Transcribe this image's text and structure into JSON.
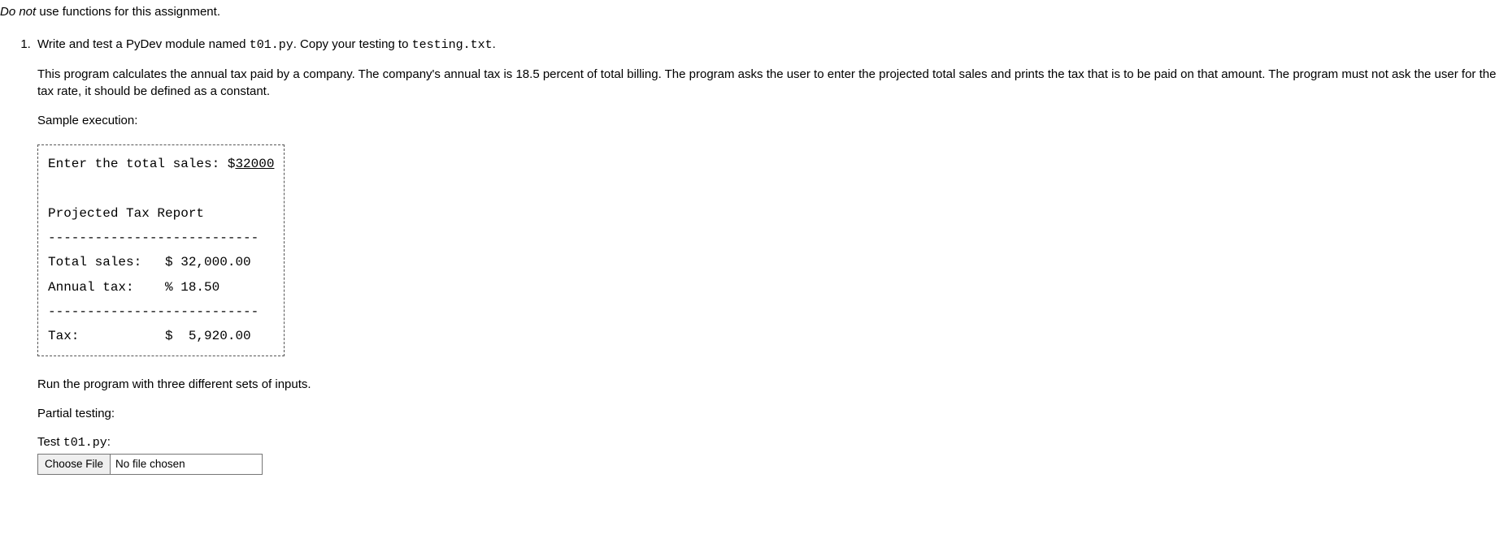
{
  "intro": {
    "italic_prefix": "Do not",
    "rest": " use functions for this assignment."
  },
  "q1": {
    "lead_a": "Write and test a PyDev module named ",
    "code_module": "t01.py",
    "lead_b": ". Copy your testing to ",
    "code_testfile": "testing.txt",
    "lead_c": ".",
    "desc": "This program calculates the annual tax paid by a company. The company's annual tax is 18.5 percent of total billing. The program asks the user to enter the projected total sales and prints the tax that is to be paid on that amount. The program must not ask the user for the tax rate, it should be defined as a constant.",
    "sample_label": "Sample execution:",
    "sample": {
      "prompt_text": "Enter the total sales: $",
      "user_input": "32000",
      "blank1": "",
      "header": "Projected Tax Report",
      "rule": "---------------------------",
      "row_total": "Total sales:   $ 32,000.00",
      "row_rate": "Annual tax:    % 18.50",
      "rule2": "---------------------------",
      "row_tax": "Tax:           $  5,920.00"
    },
    "run_note": "Run the program with three different sets of inputs.",
    "partial_label": "Partial testing:",
    "test_label_a": "Test ",
    "test_code": "t01.py",
    "test_label_b": ":",
    "file_button": "Choose File",
    "file_status": "No file chosen"
  }
}
